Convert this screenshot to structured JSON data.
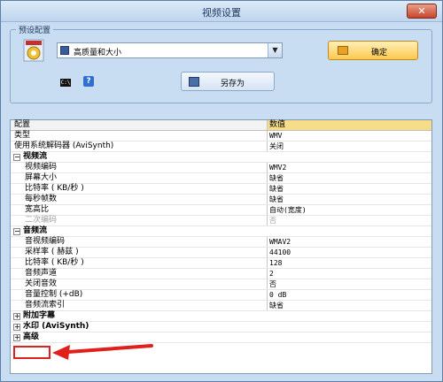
{
  "window": {
    "title": "视频设置",
    "close": "✕"
  },
  "preset": {
    "group_label": "预设配置",
    "selected": "高质量和大小",
    "ok_label": "确定",
    "saveas_label": "另存为",
    "cmd_text": "C:\\"
  },
  "grid": {
    "header": {
      "key": "配置",
      "value": "数值"
    },
    "rows": [
      {
        "type": "item",
        "key": "类型",
        "value": "WMV"
      },
      {
        "type": "item",
        "key": "使用系统解码器 (AviSynth)",
        "value": "关闭"
      },
      {
        "type": "category",
        "key": "视频流",
        "expander": "−"
      },
      {
        "type": "sub",
        "key": "视频编码",
        "value": "WMV2"
      },
      {
        "type": "sub",
        "key": "屏幕大小",
        "value": "缺省"
      },
      {
        "type": "sub",
        "key": "比特率 ( KB/秒 )",
        "value": "缺省"
      },
      {
        "type": "sub",
        "key": "每秒帧数",
        "value": "缺省"
      },
      {
        "type": "sub",
        "key": "宽高比",
        "value": "自动(宽度)"
      },
      {
        "type": "sub",
        "key": "二次编码",
        "value": "否",
        "disabled": true
      },
      {
        "type": "category",
        "key": "音频流",
        "expander": "−"
      },
      {
        "type": "sub",
        "key": "音视频编码",
        "value": "WMAV2"
      },
      {
        "type": "sub",
        "key": "采样率 ( 赫兹 )",
        "value": "44100"
      },
      {
        "type": "sub",
        "key": "比特率 ( KB/秒 )",
        "value": "128"
      },
      {
        "type": "sub",
        "key": "音频声道",
        "value": "2"
      },
      {
        "type": "sub",
        "key": "关闭音效",
        "value": "否"
      },
      {
        "type": "sub",
        "key": "音量控制 (+dB)",
        "value": "0 dB"
      },
      {
        "type": "sub",
        "key": "音频流索引",
        "value": "缺省"
      },
      {
        "type": "category",
        "key": "附加字幕",
        "expander": "+"
      },
      {
        "type": "category",
        "key": "水印 (AviSynth)",
        "expander": "+"
      },
      {
        "type": "category",
        "key": "高级",
        "expander": "+"
      }
    ]
  },
  "icons": {
    "close": "close-icon",
    "preset": "video-preset-icon",
    "disk": "floppy-disk-icon",
    "ok": "folder-check-icon",
    "cmd": "command-prompt-icon",
    "help": "help-icon"
  },
  "colors": {
    "header_value_bg": "#f7dc8a",
    "ok_button": "#fcc84e",
    "annotation_red": "#e0201a"
  }
}
